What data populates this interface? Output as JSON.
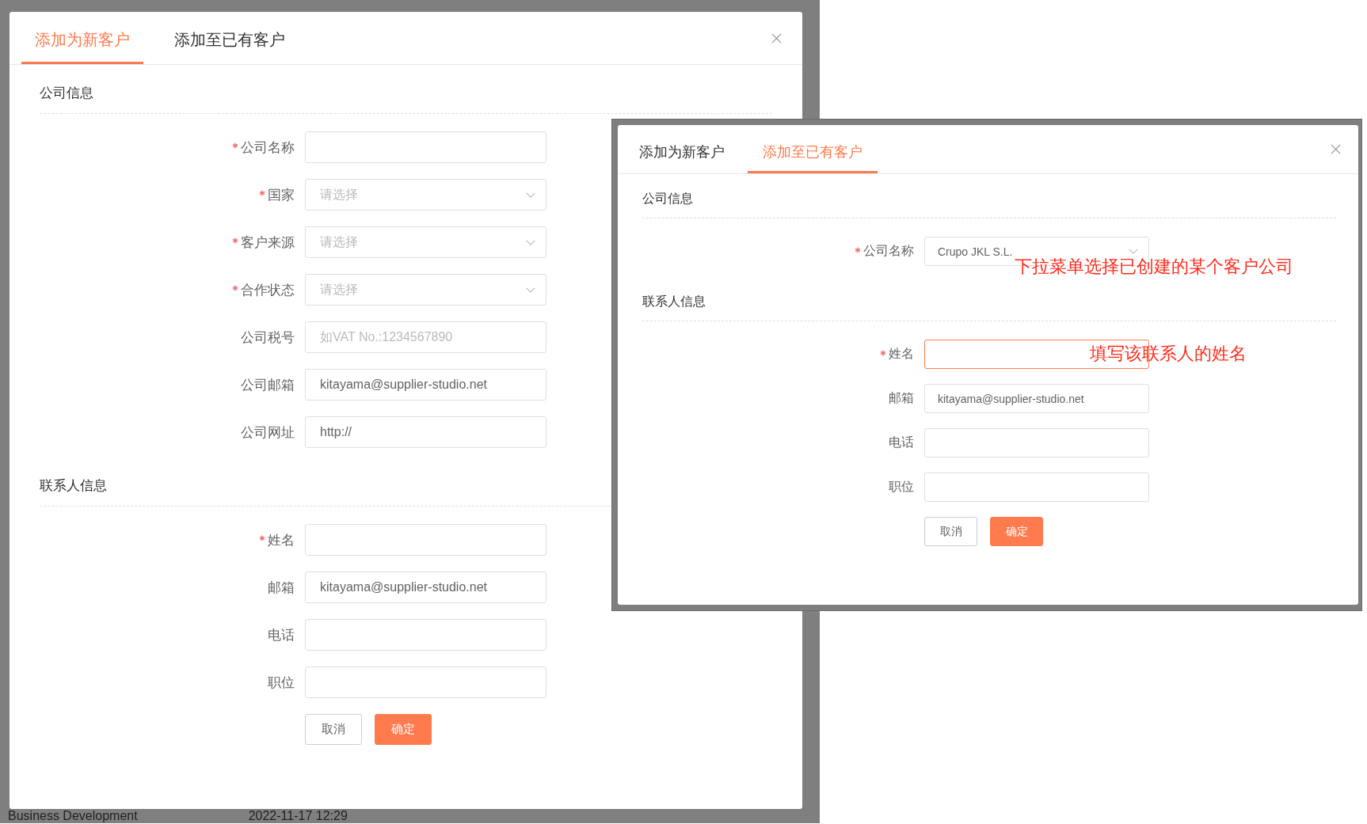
{
  "background": {
    "texts": [
      "Business Development",
      "2022-11-17 12:29"
    ]
  },
  "dialogs": [
    {
      "tabs": [
        {
          "label": "添加为新客户",
          "selected": true
        },
        {
          "label": "添加至已有客户",
          "selected": false
        }
      ],
      "sections": [
        {
          "title": "公司信息",
          "fields": [
            {
              "label": "公司名称",
              "required": true,
              "kind": "input",
              "focused": false
            },
            {
              "label": "国家",
              "required": true,
              "kind": "select",
              "placeholder": "请选择",
              "focused": false
            },
            {
              "label": "客户来源",
              "required": true,
              "kind": "select",
              "placeholder": "请选择",
              "focused": false
            },
            {
              "label": "合作状态",
              "required": true,
              "kind": "select",
              "placeholder": "请选择",
              "focused": false
            },
            {
              "label": "公司税号",
              "required": false,
              "kind": "input",
              "placeholder": "如VAT No.:1234567890",
              "focused": false
            },
            {
              "label": "公司邮箱",
              "required": false,
              "kind": "input",
              "value": "kitayama@supplier-studio.net",
              "focused": false
            },
            {
              "label": "公司网址",
              "required": false,
              "kind": "input",
              "value": "http://",
              "focused": false
            }
          ]
        },
        {
          "title": "联系人信息",
          "fields": [
            {
              "label": "姓名",
              "required": true,
              "kind": "input",
              "focused": false
            },
            {
              "label": "邮箱",
              "required": false,
              "kind": "input",
              "value": "kitayama@supplier-studio.net",
              "focused": false
            },
            {
              "label": "电话",
              "required": false,
              "kind": "input",
              "focused": false
            },
            {
              "label": "职位",
              "required": false,
              "kind": "input",
              "focused": false
            }
          ]
        }
      ],
      "buttons": [
        {
          "label": "取消",
          "kind": "default"
        },
        {
          "label": "确定",
          "kind": "primary"
        }
      ]
    },
    {
      "tabs": [
        {
          "label": "添加为新客户",
          "selected": false
        },
        {
          "label": "添加至已有客户",
          "selected": true
        }
      ],
      "sections": [
        {
          "title": "公司信息",
          "fields": [
            {
              "label": "公司名称",
              "required": true,
              "kind": "select",
              "value": "Crupo JKL S.L.",
              "focused": false,
              "annotation": "下拉菜单选择已创建的某个客户公司"
            }
          ]
        },
        {
          "title": "联系人信息",
          "fields": [
            {
              "label": "姓名",
              "required": true,
              "kind": "input",
              "focused": true,
              "annotation": "填写该联系人的姓名"
            },
            {
              "label": "邮箱",
              "required": false,
              "kind": "input",
              "value": "kitayama@supplier-studio.net",
              "focused": false
            },
            {
              "label": "电话",
              "required": false,
              "kind": "input",
              "focused": false
            },
            {
              "label": "职位",
              "required": false,
              "kind": "input",
              "focused": false
            }
          ]
        }
      ],
      "buttons": [
        {
          "label": "取消",
          "kind": "default"
        },
        {
          "label": "确定",
          "kind": "primary"
        }
      ]
    }
  ]
}
